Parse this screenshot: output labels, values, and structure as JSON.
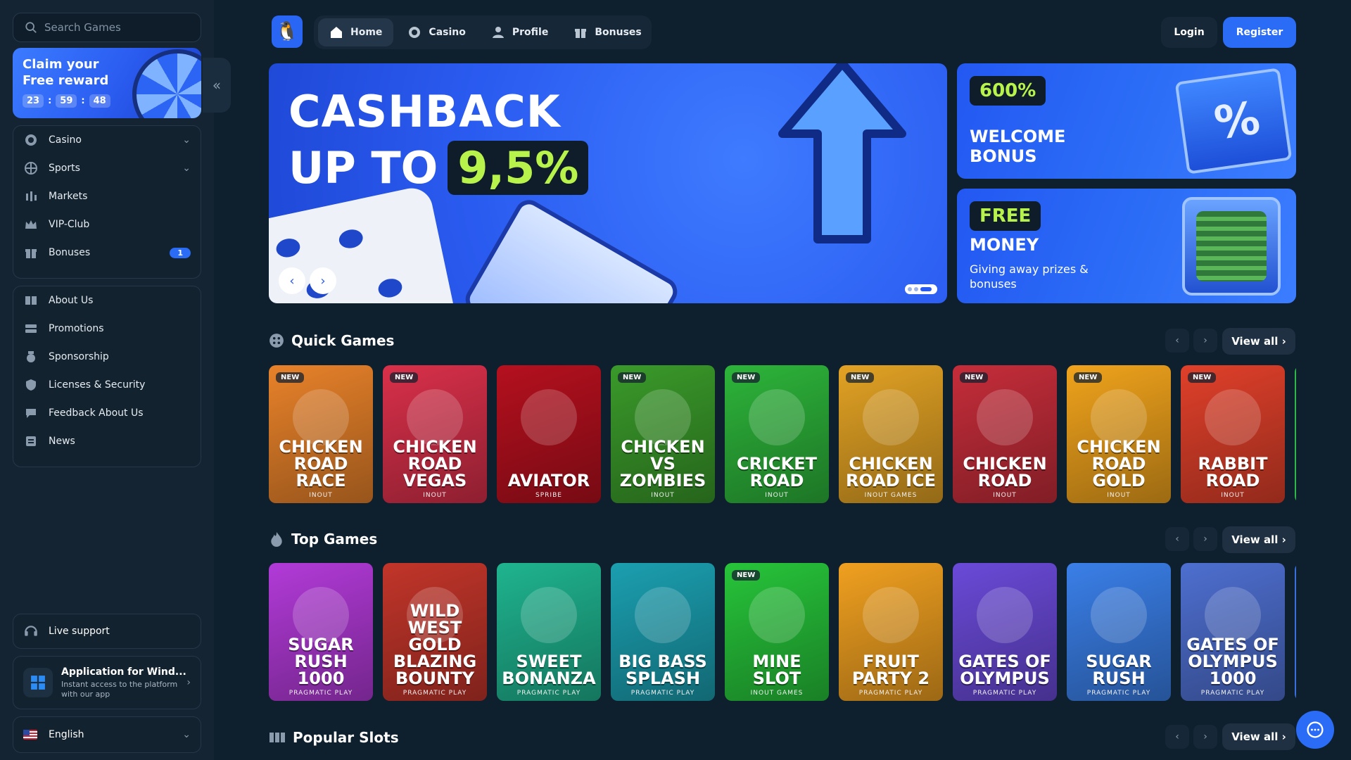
{
  "search": {
    "placeholder": "Search Games"
  },
  "reward": {
    "title": "Claim your Free reward",
    "hours": "23",
    "minutes": "59",
    "seconds": "48"
  },
  "sidebar": {
    "main": [
      {
        "label": "Casino",
        "icon": "casino-chip-icon"
      },
      {
        "label": "Sports",
        "icon": "sports-ball-icon"
      },
      {
        "label": "Markets",
        "icon": "markets-icon"
      },
      {
        "label": "VIP-Club",
        "icon": "crown-icon"
      },
      {
        "label": "Bonuses",
        "icon": "gift-icon",
        "badge": "1"
      }
    ],
    "info": [
      {
        "label": "About Us",
        "icon": "book-icon"
      },
      {
        "label": "Promotions",
        "icon": "tickets-icon"
      },
      {
        "label": "Sponsorship",
        "icon": "medal-icon"
      },
      {
        "label": "Licenses & Security",
        "icon": "shield-icon"
      },
      {
        "label": "Feedback About Us",
        "icon": "feedback-icon"
      },
      {
        "label": "News",
        "icon": "news-icon"
      }
    ],
    "support": "Live support",
    "app_title": "Application for Wind...",
    "app_sub": "Instant access to the platform with our app",
    "language": "English"
  },
  "topnav": {
    "tabs": [
      {
        "label": "Home",
        "icon": "home-icon",
        "active": true
      },
      {
        "label": "Casino",
        "icon": "casino-chip-icon"
      },
      {
        "label": "Profile",
        "icon": "user-icon"
      },
      {
        "label": "Bonuses",
        "icon": "gift-icon"
      }
    ],
    "login": "Login",
    "register": "Register"
  },
  "hero": {
    "line1": "CASHBACK",
    "line2": "UP TO",
    "percent": "9,5%",
    "slide": 3,
    "slides": 3
  },
  "banners": {
    "welcome": {
      "pill": "600%",
      "title": "WELCOME BONUS"
    },
    "money": {
      "pill": "FREE",
      "title": "MONEY",
      "subtitle": "Giving away prizes & bonuses"
    }
  },
  "sections": {
    "quick": {
      "title": "Quick Games",
      "view_all": "View all"
    },
    "top": {
      "title": "Top Games",
      "view_all": "View all"
    },
    "popular": {
      "title": "Popular Slots",
      "view_all": "View all"
    }
  },
  "quick_games": [
    {
      "name": "Chicken Road Race",
      "provider": "INOUT",
      "new": "NEW",
      "color": "#e8822a"
    },
    {
      "name": "Chicken Road Vegas",
      "provider": "INOUT",
      "new": "NEW",
      "color": "#d9304a"
    },
    {
      "name": "Aviator",
      "provider": "SPRIBE",
      "new": "",
      "color": "#b5101e"
    },
    {
      "name": "Chicken vs Zombies",
      "provider": "INOUT",
      "new": "NEW",
      "color": "#3a9a2a"
    },
    {
      "name": "Cricket Road",
      "provider": "INOUT",
      "new": "NEW",
      "color": "#2db43a"
    },
    {
      "name": "Chicken Road Ice",
      "provider": "INOUT GAMES",
      "new": "NEW",
      "color": "#e2a224"
    },
    {
      "name": "Chicken Road",
      "provider": "INOUT",
      "new": "NEW",
      "color": "#c52d3a"
    },
    {
      "name": "Chicken Road Gold",
      "provider": "INOUT",
      "new": "NEW",
      "color": "#f0a31c"
    },
    {
      "name": "Rabbit Road",
      "provider": "INOUT",
      "new": "NEW",
      "color": "#e0402a"
    }
  ],
  "top_games": [
    {
      "name": "Sugar Rush 1000",
      "provider": "PRAGMATIC PLAY",
      "new": "",
      "color": "#b23ad8"
    },
    {
      "name": "Wild West Gold Blazing Bounty",
      "provider": "PRAGMATIC PLAY",
      "new": "",
      "color": "#c2352a"
    },
    {
      "name": "Sweet Bonanza",
      "provider": "PRAGMATIC PLAY",
      "new": "",
      "color": "#1fb48f"
    },
    {
      "name": "Big Bass Splash",
      "provider": "PRAGMATIC PLAY",
      "new": "",
      "color": "#1b9fb0"
    },
    {
      "name": "Mine Slot",
      "provider": "INOUT GAMES",
      "new": "NEW",
      "color": "#27c43a"
    },
    {
      "name": "Fruit Party 2",
      "provider": "PRAGMATIC PLAY",
      "new": "",
      "color": "#f0a020"
    },
    {
      "name": "Gates of Olympus",
      "provider": "PRAGMATIC PLAY",
      "new": "",
      "color": "#6a4ad8"
    },
    {
      "name": "Sugar Rush",
      "provider": "PRAGMATIC PLAY",
      "new": "",
      "color": "#3a7fe8"
    },
    {
      "name": "Gates of Olympus 1000",
      "provider": "PRAGMATIC PLAY",
      "new": "",
      "color": "#4e6fd0"
    }
  ],
  "colors": {
    "accent": "#2b6cf6",
    "lime": "#b7f34a",
    "bg": "#0e1f2e",
    "sidebar": "#142433"
  }
}
